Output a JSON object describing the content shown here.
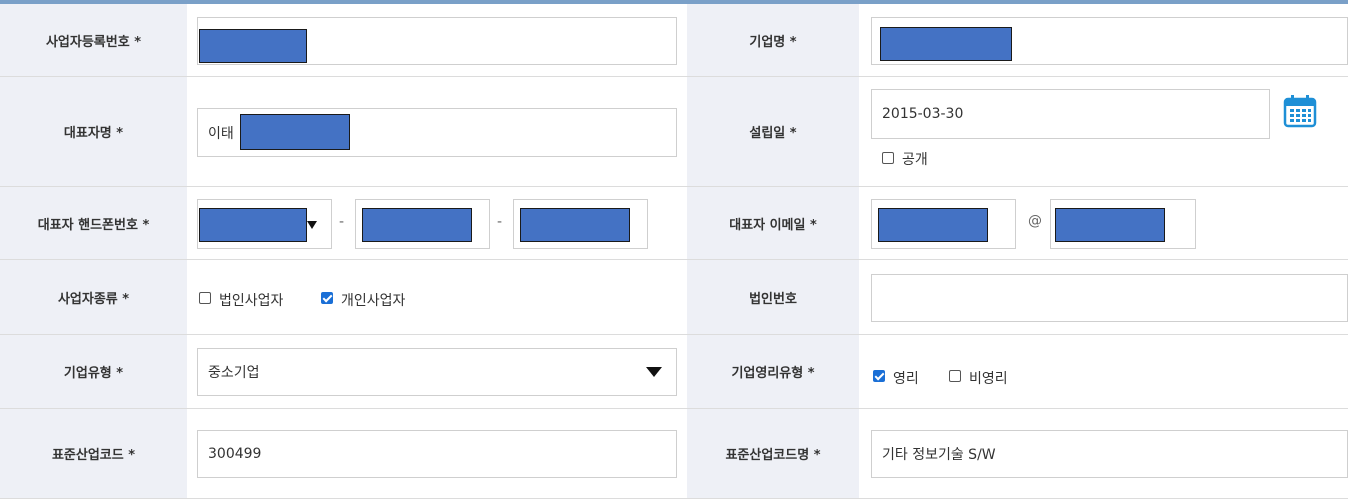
{
  "labels": {
    "biz_reg_no": "사업자등록번호 *",
    "company_name": "기업명 *",
    "ceo_name": "대표자명 *",
    "founded_date": "설립일 *",
    "ceo_phone": "대표자 핸드폰번호 *",
    "ceo_email": "대표자 이메일 *",
    "biz_type": "사업자종류 *",
    "corp_no": "법인번호",
    "company_type": "기업유형 *",
    "profit_type": "기업영리유형 *",
    "industry_code": "표준산업코드 *",
    "industry_name": "표준산업코드명 *"
  },
  "values": {
    "ceo_name_partial": "이태",
    "founded_date": "2015-03-30",
    "company_type": "중소기업",
    "industry_code": "300499",
    "industry_name": "기타 정보기술 S/W",
    "phone_sep": "-",
    "email_at": "@"
  },
  "options": {
    "public": {
      "label": "공개",
      "checked": false
    },
    "corporate": {
      "label": "법인사업자",
      "checked": false
    },
    "individual": {
      "label": "개인사업자",
      "checked": true
    },
    "profit": {
      "label": "영리",
      "checked": true
    },
    "nonprofit": {
      "label": "비영리",
      "checked": false
    }
  },
  "icons": {
    "calendar": "calendar-icon"
  },
  "colors": {
    "label_bg": "#eef0f6",
    "redaction": "#4472c4",
    "accent": "#1a6fd6",
    "top_line": "#7aa0c8"
  }
}
